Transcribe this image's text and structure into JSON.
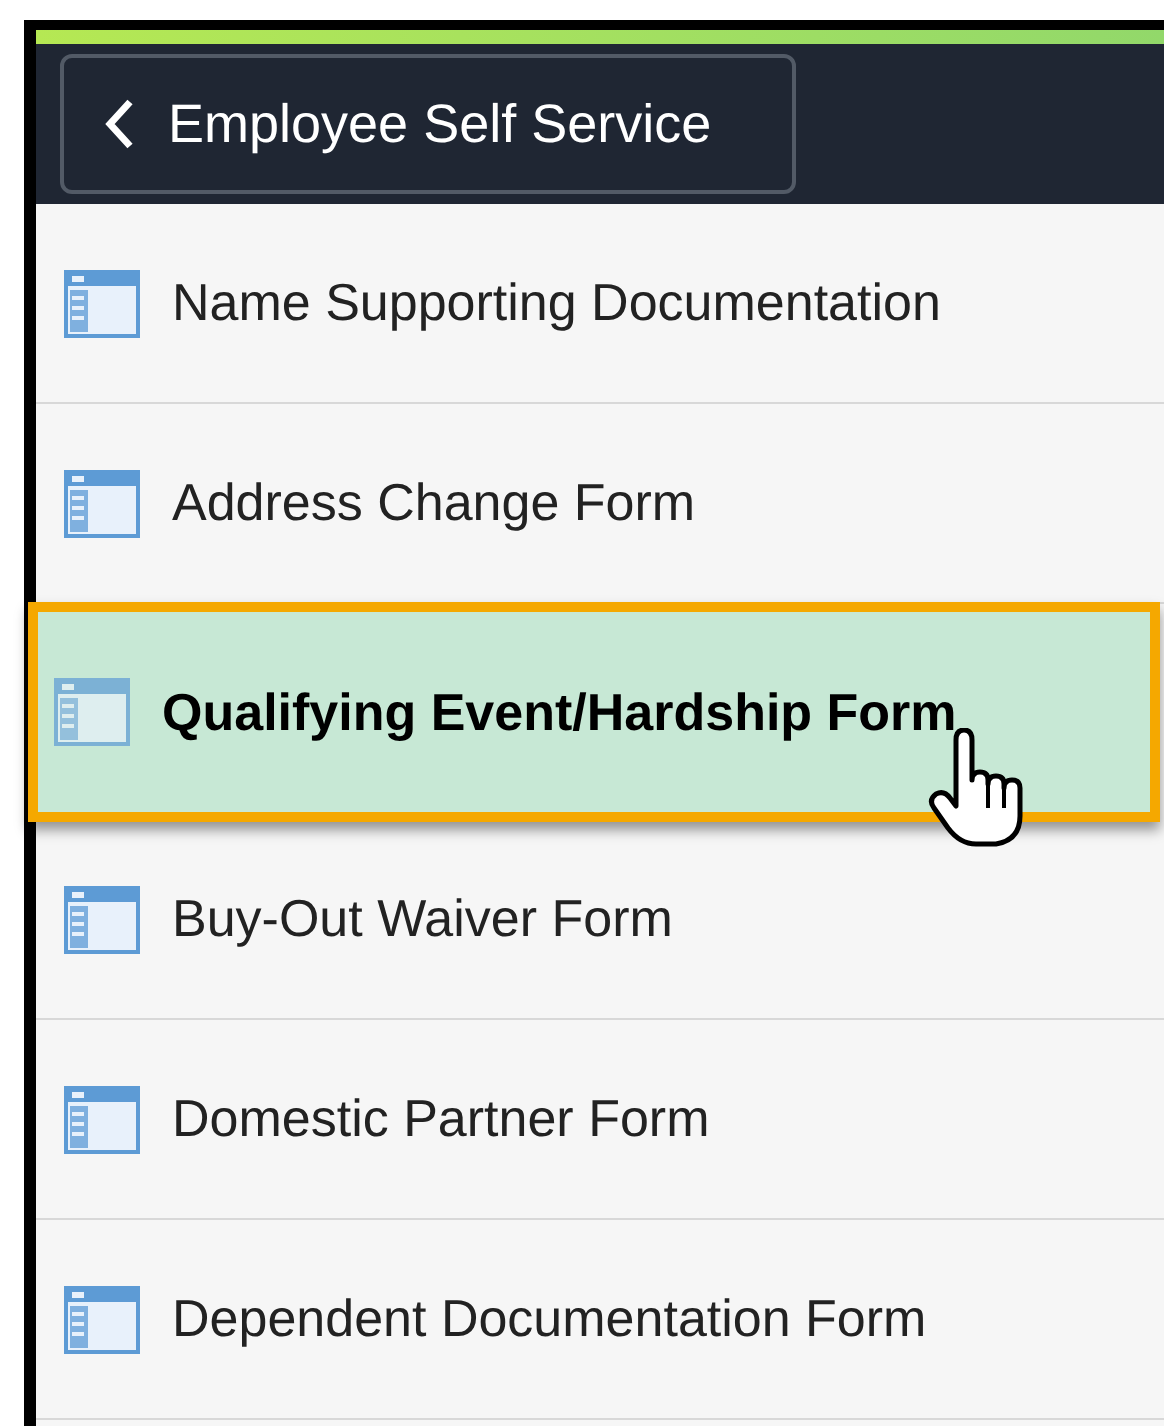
{
  "header": {
    "back_button": {
      "label": "Employee Self Service"
    }
  },
  "menu": [
    {
      "label": "Name Supporting Documentation",
      "selected": false
    },
    {
      "label": "Address Change Form",
      "selected": false
    },
    {
      "label": "Qualifying Event/Hardship Form",
      "selected": true
    },
    {
      "label": "Buy-Out Waiver Form",
      "selected": false
    },
    {
      "label": "Domestic Partner Form",
      "selected": false
    },
    {
      "label": "Dependent Documentation Form",
      "selected": false
    }
  ]
}
